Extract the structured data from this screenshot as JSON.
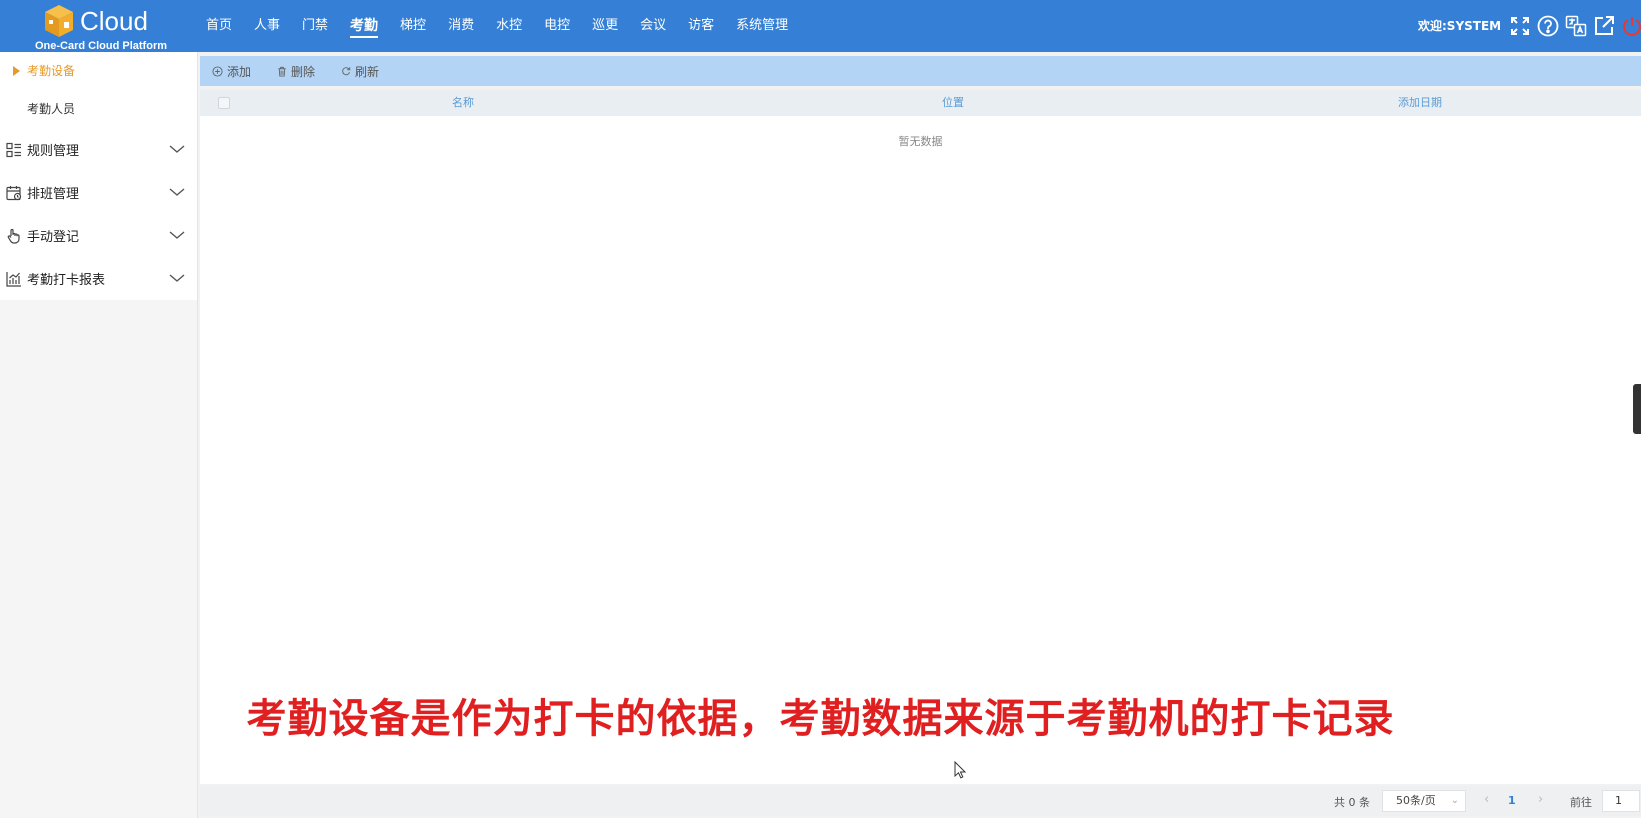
{
  "header": {
    "logo_word": "Cloud",
    "logo_sub": "One-Card Cloud Platform",
    "nav": [
      {
        "label": "首页",
        "active": false
      },
      {
        "label": "人事",
        "active": false
      },
      {
        "label": "门禁",
        "active": false
      },
      {
        "label": "考勤",
        "active": true
      },
      {
        "label": "梯控",
        "active": false
      },
      {
        "label": "消费",
        "active": false
      },
      {
        "label": "水控",
        "active": false
      },
      {
        "label": "电控",
        "active": false
      },
      {
        "label": "巡更",
        "active": false
      },
      {
        "label": "会议",
        "active": false
      },
      {
        "label": "访客",
        "active": false
      },
      {
        "label": "系统管理",
        "active": false
      }
    ],
    "welcome": "欢迎:SYSTEM",
    "icons": [
      "fullscreen-icon",
      "help-icon",
      "language-icon",
      "external-link-icon",
      "power-icon"
    ],
    "power_color": "#e53935"
  },
  "sidebar": {
    "sub_items": [
      {
        "label": "考勤设备",
        "active": true
      },
      {
        "label": "考勤人员",
        "active": false
      }
    ],
    "groups": [
      {
        "label": "规则管理",
        "icon": "rules-list-icon"
      },
      {
        "label": "排班管理",
        "icon": "calendar-icon"
      },
      {
        "label": "手动登记",
        "icon": "hand-pointer-icon"
      },
      {
        "label": "考勤打卡报表",
        "icon": "bar-chart-icon"
      }
    ],
    "active_color": "#e59a2b"
  },
  "toolbar": {
    "add_label": "添加",
    "delete_label": "删除",
    "refresh_label": "刷新"
  },
  "table": {
    "columns": [
      "名称",
      "位置",
      "添加日期"
    ],
    "empty_text": "暂无数据"
  },
  "subtitle": "考勤设备是作为打卡的依据，考勤数据来源于考勤机的打卡记录",
  "pager": {
    "total": "共 0 条",
    "page_size": "50条/页",
    "current_page": "1",
    "goto_label": "前往",
    "goto_value": "1"
  },
  "colors": {
    "header_bg": "#3580d6",
    "toolbar_bg": "#b3d4f5",
    "subtitle": "#e02020"
  }
}
